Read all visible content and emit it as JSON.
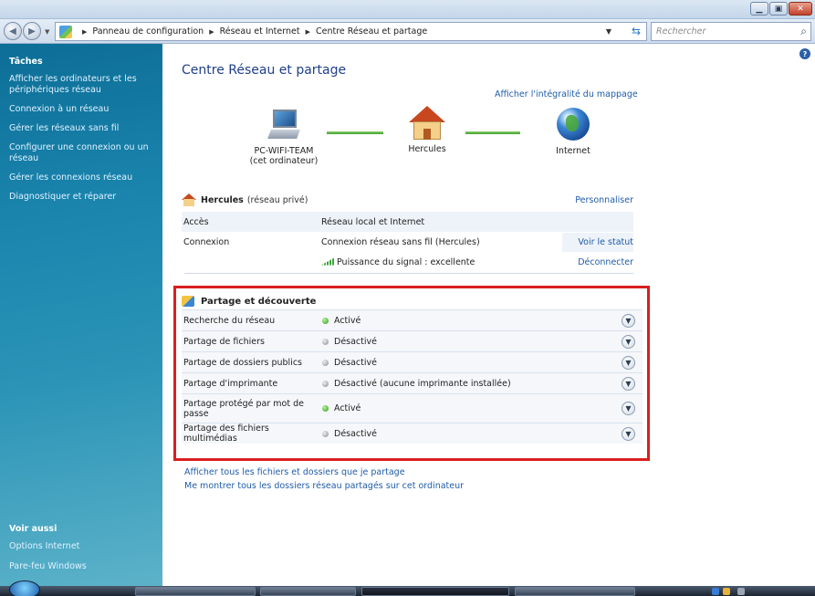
{
  "window": {
    "buttons": [
      "minimize",
      "maximize",
      "close"
    ]
  },
  "navbar": {
    "breadcrumbs": [
      "Panneau de configuration",
      "Réseau et Internet",
      "Centre Réseau et partage"
    ],
    "search_placeholder": "Rechercher"
  },
  "sidebar": {
    "section_title": "Tâches",
    "links": [
      "Afficher les ordinateurs et les périphériques réseau",
      "Connexion à un réseau",
      "Gérer les réseaux sans fil",
      "Configurer une connexion ou un réseau",
      "Gérer les connexions réseau",
      "Diagnostiquer et réparer"
    ],
    "see_also_title": "Voir aussi",
    "see_also_links": [
      "Options Internet",
      "Pare-feu Windows"
    ]
  },
  "main": {
    "title": "Centre Réseau et partage",
    "map_link": "Afficher l'intégralité du mappage",
    "nodes": {
      "computer_name": "PC-WIFI-TEAM",
      "computer_sub": "(cet ordinateur)",
      "network": "Hercules",
      "internet": "Internet"
    },
    "network": {
      "name": "Hercules",
      "type": "(réseau privé)",
      "customize": "Personnaliser",
      "rows": [
        {
          "key": "Accès",
          "value": "Réseau local et Internet",
          "action": ""
        },
        {
          "key": "Connexion",
          "value": "Connexion réseau sans fil (Hercules)",
          "action": "Voir le statut"
        },
        {
          "key": "",
          "value": "Puissance du signal : excellente",
          "action": "Déconnecter"
        }
      ]
    },
    "sharing": {
      "title": "Partage et découverte",
      "rows": [
        {
          "key": "Recherche du réseau",
          "status": "Activé",
          "on": true
        },
        {
          "key": "Partage de fichiers",
          "status": "Désactivé",
          "on": false
        },
        {
          "key": "Partage de dossiers publics",
          "status": "Désactivé",
          "on": false
        },
        {
          "key": "Partage d'imprimante",
          "status": "Désactivé (aucune imprimante installée)",
          "on": false
        },
        {
          "key": "Partage protégé par mot de passe",
          "status": "Activé",
          "on": true
        },
        {
          "key": "Partage des fichiers multimédias",
          "status": "Désactivé",
          "on": false
        }
      ]
    },
    "bottom_links": [
      "Afficher tous les fichiers et dossiers que je partage",
      "Me montrer tous les dossiers réseau partagés sur cet ordinateur"
    ]
  }
}
